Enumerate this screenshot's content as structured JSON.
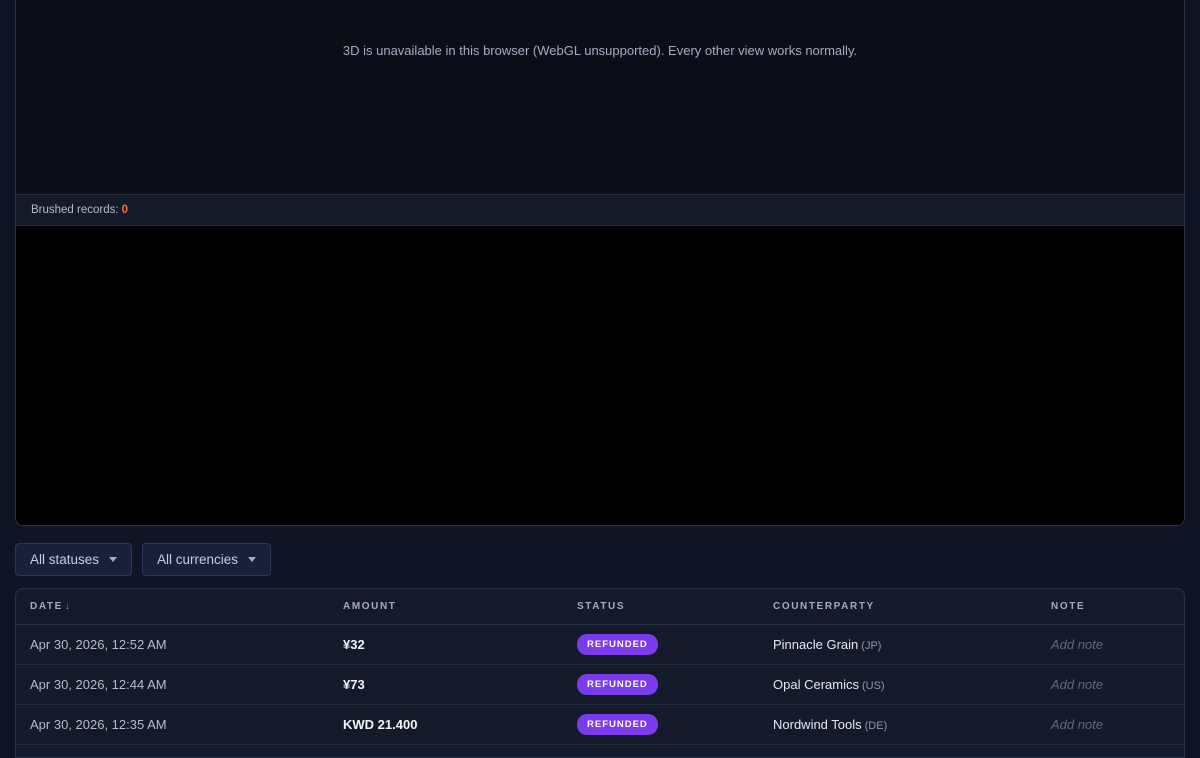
{
  "viewer": {
    "webgl_message": "3D is unavailable in this browser (WebGL unsupported). Every other view works normally.",
    "brushed_label": "Brushed records:",
    "brushed_count": "0"
  },
  "filters": {
    "status": "All statuses",
    "currency": "All currencies"
  },
  "table": {
    "columns": [
      "DATE",
      "AMOUNT",
      "STATUS",
      "COUNTERPARTY",
      "NOTE"
    ],
    "sort_indicator": "↓",
    "rows": [
      {
        "date": "Apr 30, 2026, 12:52 AM",
        "amount": "¥32",
        "status": "REFUNDED",
        "counterparty": "Pinnacle Grain",
        "country": "(JP)",
        "note": "Add note"
      },
      {
        "date": "Apr 30, 2026, 12:44 AM",
        "amount": "¥73",
        "status": "REFUNDED",
        "counterparty": "Opal Ceramics",
        "country": "(US)",
        "note": "Add note"
      },
      {
        "date": "Apr 30, 2026, 12:35 AM",
        "amount": "KWD 21.400",
        "status": "REFUNDED",
        "counterparty": "Nordwind Tools",
        "country": "(DE)",
        "note": "Add note"
      }
    ]
  },
  "colors": {
    "accent": "#ff6a3d",
    "refunded_badge": "#7c3aed",
    "background": "#0f1524"
  },
  "icons": [
    "chevron-down-icon",
    "sort-desc-icon"
  ]
}
